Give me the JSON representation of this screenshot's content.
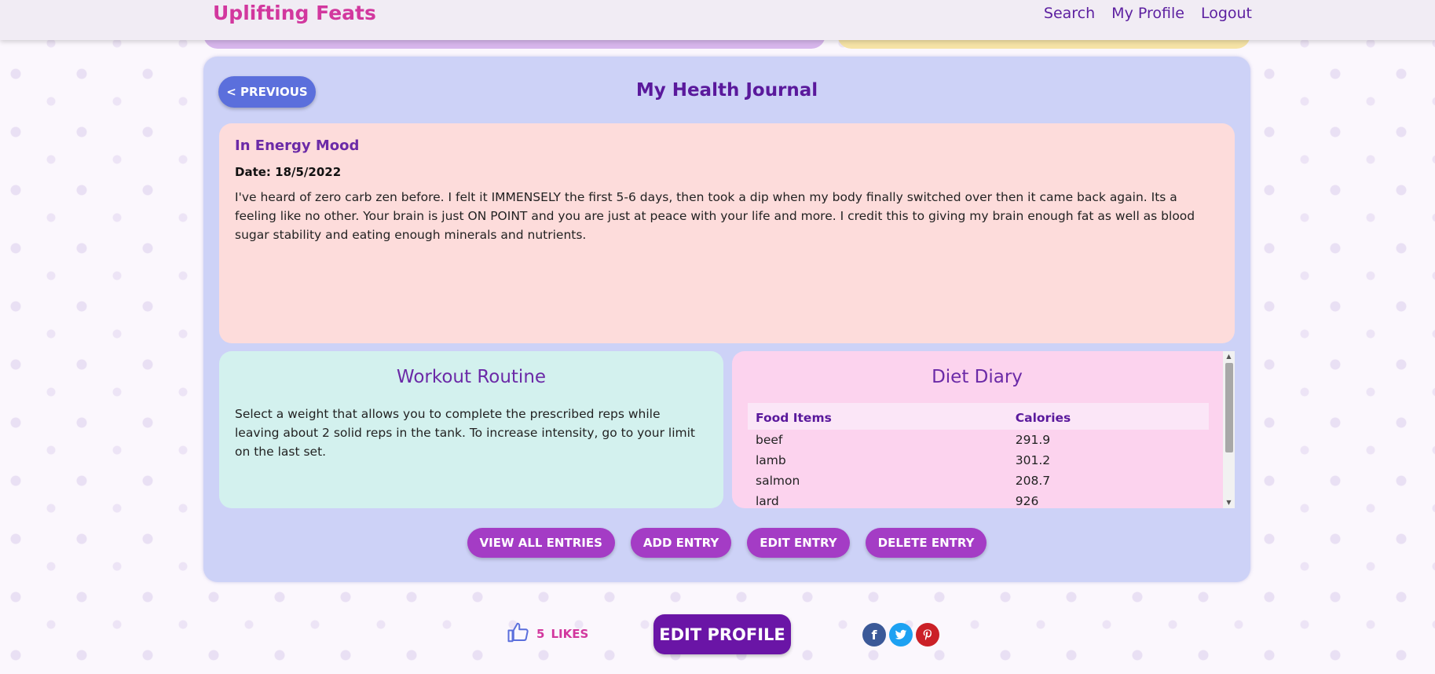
{
  "nav": {
    "brand": "Uplifting Feats",
    "links": [
      "Search",
      "My Profile",
      "Logout"
    ]
  },
  "journal": {
    "title": "My Health Journal",
    "previous_label": "< PREVIOUS",
    "entry": {
      "title": "In Energy Mood",
      "date_label": "Date: 18/5/2022",
      "body": "I've heard of zero carb zen before. I felt it IMMENSELY the first 5-6 days, then took a dip when my body finally switched over then it came back again. Its a feeling like no other. Your brain is just ON POINT and you are just at peace with your life and more. I credit this to giving my brain enough fat as well as blood sugar stability and eating enough minerals and nutrients."
    },
    "workout": {
      "heading": "Workout Routine",
      "text": "Select a weight that allows you to complete the prescribed reps while leaving about 2 solid reps in the tank. To increase intensity, go to your limit on the last set."
    },
    "diet": {
      "heading": "Diet Diary",
      "columns": [
        "Food Items",
        "Calories"
      ],
      "rows": [
        [
          "beef",
          "291.9"
        ],
        [
          "lamb",
          "301.2"
        ],
        [
          "salmon",
          "208.7"
        ],
        [
          "lard",
          "926"
        ]
      ]
    },
    "actions": [
      "VIEW ALL ENTRIES",
      "ADD ENTRY",
      "EDIT ENTRY",
      "DELETE ENTRY"
    ]
  },
  "footer": {
    "likes_count": "5",
    "likes_label": "LIKES",
    "edit_profile_label": "EDIT PROFILE",
    "social_icons": [
      "facebook-icon",
      "twitter-icon",
      "pinterest-icon"
    ]
  },
  "colors": {
    "brand": "#d2379e",
    "nav_link": "#5c1fa0",
    "panel_bg": "#cdd2f7",
    "entry_bg": "#fddcdb",
    "workout_bg": "#d3f1ee",
    "diet_bg": "#fcd3ee",
    "action_button": "#a43cc5",
    "previous_button": "#5b6fdc",
    "edit_profile_button": "#6a15a6"
  }
}
